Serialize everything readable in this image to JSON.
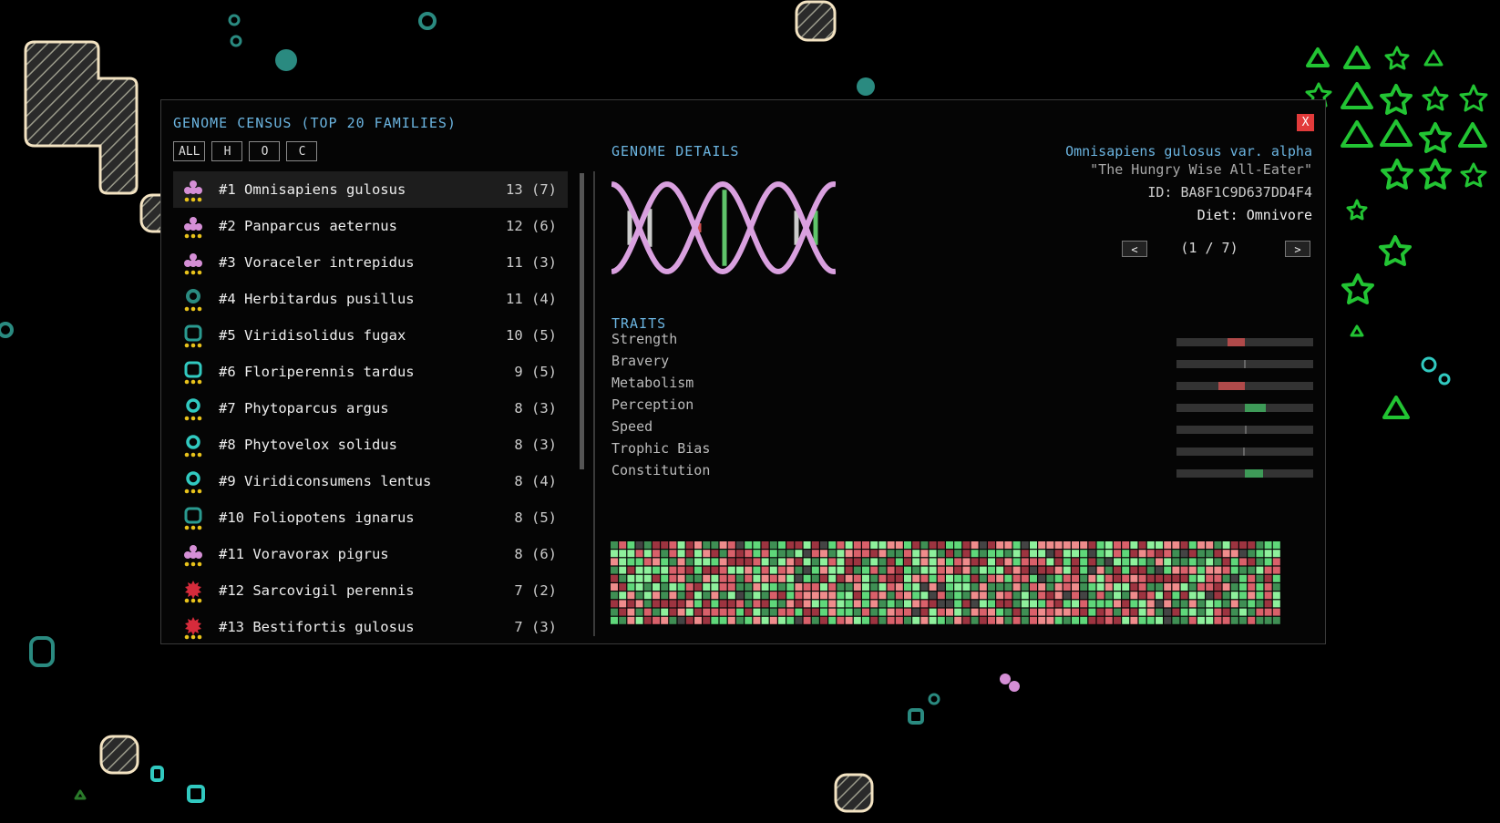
{
  "window": {
    "title": "GENOME CENSUS (TOP 20 FAMILIES)",
    "close_label": "X"
  },
  "filters": [
    {
      "label": "ALL"
    },
    {
      "label": "H"
    },
    {
      "label": "O"
    },
    {
      "label": "C"
    }
  ],
  "census": {
    "selected_index": 0,
    "families": [
      {
        "label": "#1 Omnisapiens gulosus",
        "count": "13 (7)",
        "icon": "omnivore-cluster-icon",
        "color": "#d58fd6"
      },
      {
        "label": "#2 Panparcus aeternus",
        "count": "12 (6)",
        "icon": "omnivore-cluster-icon",
        "color": "#d58fd6"
      },
      {
        "label": "#3 Voraceler intrepidus",
        "count": "11 (3)",
        "icon": "omnivore-cluster-icon",
        "color": "#d58fd6"
      },
      {
        "label": "#4 Herbitardus pusillus",
        "count": "11 (4)",
        "icon": "herbivore-blob-icon",
        "color": "#2a8a80"
      },
      {
        "label": "#5 Viridisolidus fugax",
        "count": "10 (5)",
        "icon": "herbivore-square-icon",
        "color": "#2a9a90"
      },
      {
        "label": "#6 Floriperennis tardus",
        "count": "9 (5)",
        "icon": "herbivore-square-icon",
        "color": "#31c9c0"
      },
      {
        "label": "#7 Phytoparcus argus",
        "count": "8 (3)",
        "icon": "herbivore-ring-icon",
        "color": "#31c9c0"
      },
      {
        "label": "#8 Phytovelox solidus",
        "count": "8 (3)",
        "icon": "herbivore-ring-icon",
        "color": "#31c9c0"
      },
      {
        "label": "#9 Viridiconsumens lentus",
        "count": "8 (4)",
        "icon": "herbivore-ring-icon",
        "color": "#31c9c0"
      },
      {
        "label": "#10 Foliopotens ignarus",
        "count": "8 (5)",
        "icon": "herbivore-square-icon",
        "color": "#2a9a90"
      },
      {
        "label": "#11 Voravorax pigrus",
        "count": "8 (6)",
        "icon": "omnivore-cluster-icon",
        "color": "#d58fd6"
      },
      {
        "label": "#12 Sarcovigil perennis",
        "count": "7 (2)",
        "icon": "carnivore-spike-icon",
        "color": "#d62b3b"
      },
      {
        "label": "#13 Bestifortis gulosus",
        "count": "7 (3)",
        "icon": "carnivore-spike-icon",
        "color": "#d62b3b"
      }
    ]
  },
  "details": {
    "title": "GENOME DETAILS",
    "species_name": "Omnisapiens gulosus var. alpha",
    "nickname": "\"The Hungry Wise All-Eater\"",
    "id_text": "ID: BA8F1C9D637DD4F4",
    "diet_text": "Diet: Omnivore",
    "prev_label": "<",
    "next_label": ">",
    "page_text": "(1 / 7)",
    "helix_color": "#d9a0df"
  },
  "traits": {
    "title": "TRAITS",
    "items": [
      {
        "name": "Strength",
        "value": -0.55,
        "color": "#b04a4a"
      },
      {
        "name": "Bravery",
        "value": 0.0,
        "color": "#666666"
      },
      {
        "name": "Metabolism",
        "value": -0.82,
        "color": "#b04a4a"
      },
      {
        "name": "Perception",
        "value": 0.67,
        "color": "#3e9a58"
      },
      {
        "name": "Speed",
        "value": 0.03,
        "color": "#666666"
      },
      {
        "name": "Trophic Bias",
        "value": -0.03,
        "color": "#666666"
      },
      {
        "name": "Constitution",
        "value": 0.57,
        "color": "#3e9a58"
      }
    ]
  },
  "colors": {
    "accent": "#6bb4e0",
    "close": "#e23b3b",
    "gene_palette": [
      "#3f8f54",
      "#5fd77a",
      "#8ef09c",
      "#9d3440",
      "#d9606a",
      "#ef8c8c",
      "#444444"
    ]
  }
}
